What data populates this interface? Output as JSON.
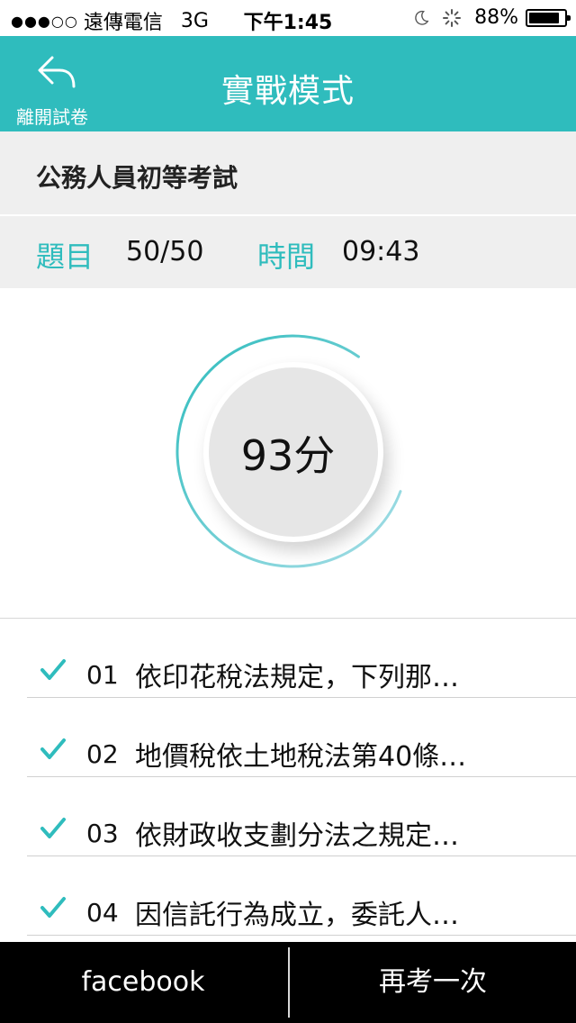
{
  "status_bar": {
    "signal": "●●●○○",
    "carrier": "遠傳電信",
    "network": "3G",
    "time": "下午1:45",
    "battery_percent": "88%",
    "battery_level": 0.88
  },
  "header": {
    "back_label": "離開試卷",
    "title": "實戰模式",
    "color": "#2fbcbd"
  },
  "exam": {
    "name": "公務人員初等考試"
  },
  "stats": {
    "questions_label": "題目",
    "questions_value": "50/50",
    "time_label": "時間",
    "time_value": "09:43"
  },
  "score": {
    "text": "93分",
    "value": 93
  },
  "questions": [
    {
      "num": "01",
      "text": "依印花稅法規定，下列那…",
      "icon": "check-icon"
    },
    {
      "num": "02",
      "text": " 地價稅依土地稅法第40條…",
      "icon": "check-icon"
    },
    {
      "num": "03",
      "text": "依財政收支劃分法之規定…",
      "icon": "check-icon"
    },
    {
      "num": "04",
      "text": " 因信託行為成立，委託人…",
      "icon": "check-icon"
    }
  ],
  "bottom_bar": {
    "facebook_label": "facebook",
    "retry_label": "再考一次"
  }
}
